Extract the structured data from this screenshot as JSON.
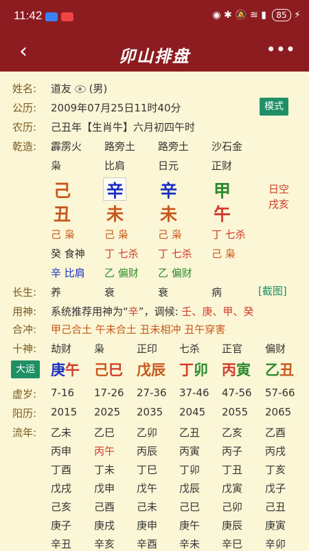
{
  "status": {
    "time": "11:42",
    "battery": "85"
  },
  "nav": {
    "title": "卯山排盘"
  },
  "info": {
    "name_label": "姓名:",
    "name": "道友",
    "gender": "(男)",
    "solar_label": "公历:",
    "solar": "2009年07月25日11时40分",
    "mode_button": "模式",
    "lunar_label": "农历:",
    "lunar": "己丑年【生肖牛】六月初四午时"
  },
  "qianzao": {
    "label": "乾造:",
    "nayin": [
      "霹雳火",
      "路旁土",
      "路旁土",
      "沙石金"
    ],
    "shishen": [
      "枭",
      "比肩",
      "日元",
      "正财"
    ],
    "tiangan": [
      "己",
      "辛",
      "辛",
      "甲"
    ],
    "dizhi": [
      "丑",
      "未",
      "未",
      "午"
    ],
    "kong1": "日空",
    "kong2": "戌亥",
    "cang1": [
      "己 枭",
      "己 枭",
      "己 枭",
      "丁 七杀"
    ],
    "cang2": [
      "癸 食神",
      "丁 七杀",
      "丁 七杀",
      "己 枭"
    ],
    "cang3": [
      "辛 比肩",
      "乙 偏财",
      "乙 偏财",
      ""
    ]
  },
  "zhangsheng": {
    "label": "长生:",
    "values": [
      "养",
      "衰",
      "衰",
      "病"
    ],
    "screenshot": "[截图]"
  },
  "yongshen": {
    "label": "用神:",
    "text_a": "系统推荐用神为“",
    "hl": "辛",
    "text_b": "”，调候: ",
    "text_c": "壬、庚、甲、癸"
  },
  "hechong": {
    "label": "合冲:",
    "text": "甲己合土  午未合土  丑未相冲  丑午穿害"
  },
  "shishen_row": {
    "label": "十神:",
    "values": [
      "劫财",
      "枭",
      "正印",
      "七杀",
      "正官",
      "偏财"
    ]
  },
  "dayun": {
    "button": "大运",
    "gan": [
      "庚",
      "己",
      "戊",
      "丁",
      "丙",
      "乙"
    ],
    "zhi": [
      "午",
      "巳",
      "辰",
      "卯",
      "寅",
      "丑"
    ]
  },
  "xusui": {
    "label": "虚岁:",
    "values": [
      "7-16",
      "17-26",
      "27-36",
      "37-46",
      "47-56",
      "57-66"
    ]
  },
  "yangli": {
    "label": "阳历:",
    "values": [
      "2015",
      "2025",
      "2035",
      "2045",
      "2055",
      "2065"
    ]
  },
  "liunian": {
    "label": "流年:",
    "rows": [
      [
        "乙未",
        "乙巳",
        "乙卯",
        "乙丑",
        "乙亥",
        "乙酉"
      ],
      [
        "丙申",
        "丙午",
        "丙辰",
        "丙寅",
        "丙子",
        "丙戌"
      ],
      [
        "丁酉",
        "丁未",
        "丁巳",
        "丁卯",
        "丁丑",
        "丁亥"
      ],
      [
        "戊戌",
        "戊申",
        "戊午",
        "戊辰",
        "戊寅",
        "戊子"
      ],
      [
        "己亥",
        "己酉",
        "己未",
        "己巳",
        "己卯",
        "己丑"
      ],
      [
        "庚子",
        "庚戌",
        "庚申",
        "庚午",
        "庚辰",
        "庚寅"
      ],
      [
        "辛丑",
        "辛亥",
        "辛酉",
        "辛未",
        "辛巳",
        "辛卯"
      ]
    ]
  },
  "colors": {
    "header": "#8c1c20",
    "bg": "#fbf6d6",
    "accent": "#1e8f66",
    "orange": "#c8571b",
    "blue": "#1a2fc2",
    "green": "#2d8a2d",
    "red": "#d23a2a"
  }
}
